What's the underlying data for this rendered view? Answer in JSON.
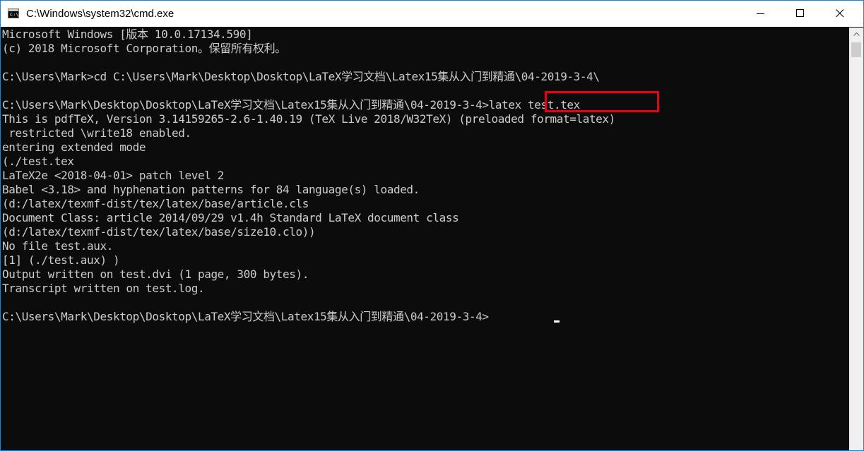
{
  "window": {
    "title": "C:\\Windows\\system32\\cmd.exe",
    "icon_text": "C:\\."
  },
  "console": {
    "lines": [
      "Microsoft Windows [版本 10.0.17134.590]",
      "(c) 2018 Microsoft Corporation。保留所有权利。",
      "",
      "C:\\Users\\Mark>cd C:\\Users\\Mark\\Desktop\\Dosktop\\LaTeX学习文档\\Latex15集从入门到精通\\04-2019-3-4\\",
      "",
      "C:\\Users\\Mark\\Desktop\\Dosktop\\LaTeX学习文档\\Latex15集从入门到精通\\04-2019-3-4>latex test.tex",
      "This is pdfTeX, Version 3.14159265-2.6-1.40.19 (TeX Live 2018/W32TeX) (preloaded format=latex)",
      " restricted \\write18 enabled.",
      "entering extended mode",
      "(./test.tex",
      "LaTeX2e <2018-04-01> patch level 2",
      "Babel <3.18> and hyphenation patterns for 84 language(s) loaded.",
      "(d:/latex/texmf-dist/tex/latex/base/article.cls",
      "Document Class: article 2014/09/29 v1.4h Standard LaTeX document class",
      "(d:/latex/texmf-dist/tex/latex/base/size10.clo))",
      "No file test.aux.",
      "[1] (./test.aux) )",
      "Output written on test.dvi (1 page, 300 bytes).",
      "Transcript written on test.log.",
      "",
      "C:\\Users\\Mark\\Desktop\\Dosktop\\LaTeX学习文档\\Latex15集从入门到精通\\04-2019-3-4>"
    ]
  },
  "colors": {
    "console_bg": "#0c0c0c",
    "console_text": "#cccccc",
    "highlight": "#e8001a"
  }
}
